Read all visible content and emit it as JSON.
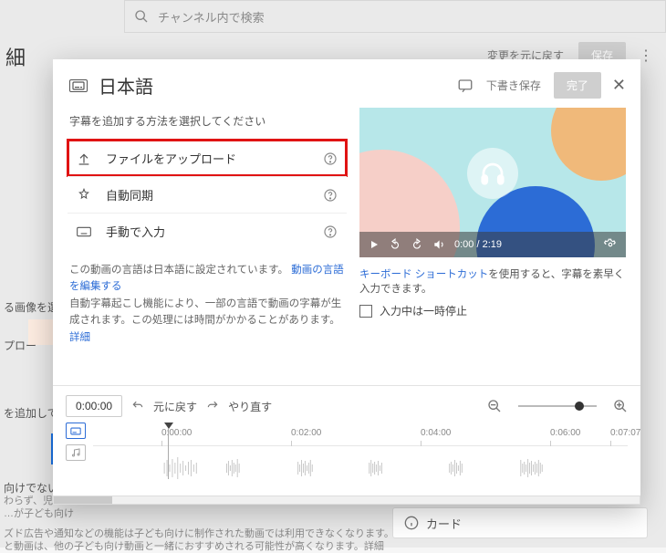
{
  "bg": {
    "search_placeholder": "チャンネル内で検索",
    "heading": "細",
    "undo_changes": "変更を元に戻す",
    "save": "保存",
    "left_pick_image": "る画像を選択し",
    "left_upload": "プロー",
    "left_add": "を追加して、視聴",
    "left_nochild_title": "向けでない動画…",
    "left_nochild_line1": "わらず、児童",
    "left_nochild_line2": "…が子ども向け",
    "footer_line1": "ズド広告や通知などの機能は子ども向けに制作された動画では利用できなくなります。ご自身で子ども向",
    "footer_line2": "と動画は、他の子ども向け動画と一緒におすすめされる可能性が高くなります。詳細",
    "card_label": "カード"
  },
  "dialog": {
    "language": "日本語",
    "draft_save": "下書き保存",
    "done": "完了",
    "prompt": "字幕を追加する方法を選択してください",
    "options": {
      "upload": "ファイルをアップロード",
      "autosync": "自動同期",
      "manual": "手動で入力"
    },
    "note_prefix": "この動画の言語は日本語に設定されています。",
    "note_edit_link": "動画の言語を編集する",
    "note_autocap": "自動字幕起こし機能により、一部の言語で動画の字幕が生成されます。この処理には時間がかかることがあります。",
    "note_more": "詳細"
  },
  "video": {
    "time_display": "0:00 / 2:19",
    "hint_link": "キーボード ショートカット",
    "hint_rest": "を使用すると、字幕を素早く入力できます。",
    "pause_label": "入力中は一時停止"
  },
  "timeline": {
    "timecode": "0:00:00",
    "undo": "元に戻す",
    "redo": "やり直す",
    "marks": [
      "0:00:00",
      "0:02:00",
      "0:04:00",
      "0:06:00",
      "0:07:07"
    ]
  }
}
